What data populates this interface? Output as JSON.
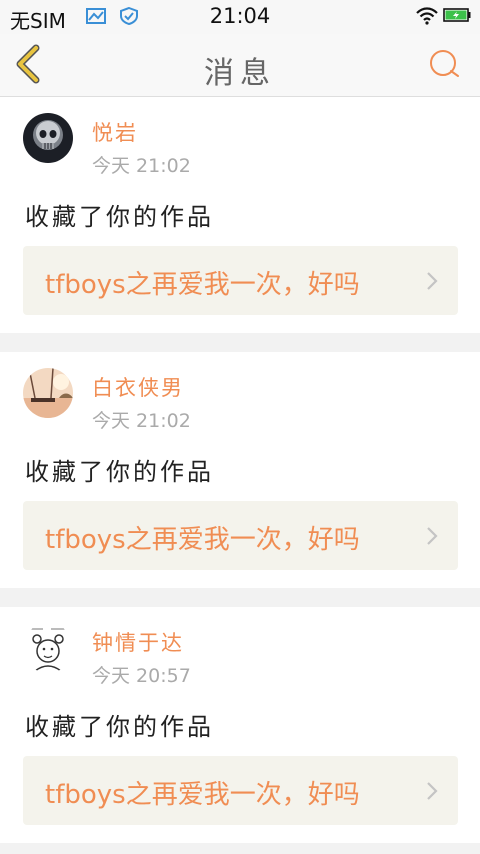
{
  "status_bar": {
    "carrier": "无SIM",
    "time": "21:04"
  },
  "nav": {
    "title": "消息"
  },
  "colors": {
    "accent": "#f08d53",
    "back_arrow": "#e8c440"
  },
  "messages": [
    {
      "username": "悦岩",
      "time": "今天 21:02",
      "action": "收藏了你的作品",
      "work_title": "tfboys之再爱我一次，好吗"
    },
    {
      "username": "白衣侠男",
      "time": "今天 21:02",
      "action": "收藏了你的作品",
      "work_title": "tfboys之再爱我一次，好吗"
    },
    {
      "username": "钟情于达",
      "time": "今天 20:57",
      "action": "收藏了你的作品",
      "work_title": "tfboys之再爱我一次，好吗"
    }
  ]
}
